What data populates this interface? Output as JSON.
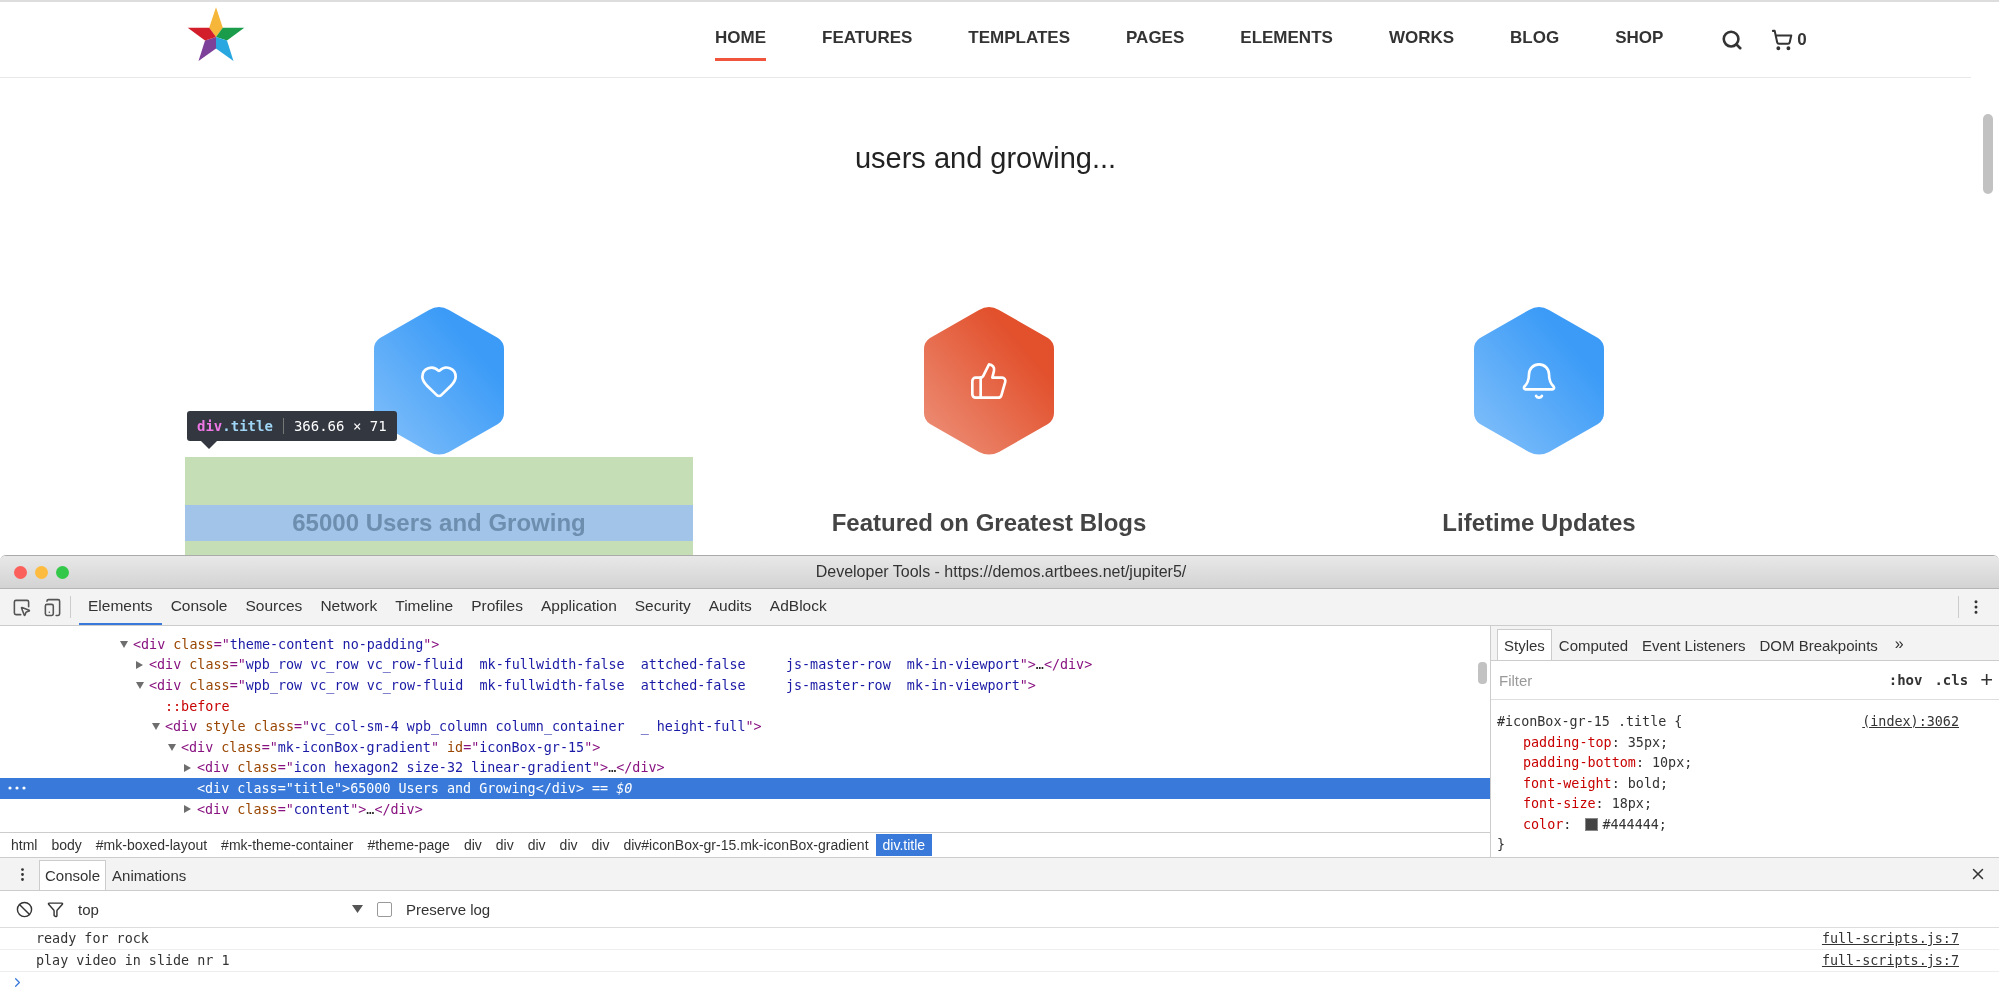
{
  "site": {
    "nav": [
      {
        "label": "HOME",
        "selected": true
      },
      {
        "label": "FEATURES",
        "selected": false
      },
      {
        "label": "TEMPLATES",
        "selected": false
      },
      {
        "label": "PAGES",
        "selected": false
      },
      {
        "label": "ELEMENTS",
        "selected": false
      },
      {
        "label": "WORKS",
        "selected": false
      },
      {
        "label": "BLOG",
        "selected": false
      },
      {
        "label": "SHOP",
        "selected": false
      }
    ],
    "cart_count": "0",
    "tagline": "users and growing...",
    "features": [
      {
        "title": "65000 Users and Growing",
        "color": "#3b9bf7",
        "highlighted": true
      },
      {
        "title": "Featured on Greatest Blogs",
        "color": "#e2502c",
        "highlighted": false
      },
      {
        "title": "Lifetime Updates",
        "color": "#3b9bf7",
        "highlighted": false
      }
    ],
    "inspect_tooltip": {
      "tag": "div",
      "class_name": ".title",
      "size": "366.66 × 71"
    }
  },
  "devtools": {
    "title": "Developer Tools - https://demos.artbees.net/jupiter5/",
    "tabs": [
      {
        "label": "Elements",
        "selected": true
      },
      {
        "label": "Console",
        "selected": false
      },
      {
        "label": "Sources",
        "selected": false
      },
      {
        "label": "Network",
        "selected": false
      },
      {
        "label": "Timeline",
        "selected": false
      },
      {
        "label": "Profiles",
        "selected": false
      },
      {
        "label": "Application",
        "selected": false
      },
      {
        "label": "Security",
        "selected": false
      },
      {
        "label": "Audits",
        "selected": false
      },
      {
        "label": "AdBlock",
        "selected": false
      }
    ],
    "dom_tree": [
      {
        "expanded": true,
        "selected": false,
        "segments": [
          {
            "kind": "tag",
            "text": "<div "
          },
          {
            "kind": "attr",
            "text": "class"
          },
          {
            "kind": "tag",
            "text": "=\""
          },
          {
            "kind": "value",
            "text": "theme-content no-padding"
          },
          {
            "kind": "tag",
            "text": "\">"
          }
        ],
        "children": [
          {
            "expanded": false,
            "selected": false,
            "segments": [
              {
                "kind": "tag",
                "text": "<div "
              },
              {
                "kind": "attr",
                "text": "class"
              },
              {
                "kind": "tag",
                "text": "=\""
              },
              {
                "kind": "value",
                "text": "wpb_row vc_row vc_row-fluid  mk-fullwidth-false  attched-false     js-master-row  mk-in-viewport"
              },
              {
                "kind": "tag",
                "text": "\">"
              },
              {
                "kind": "text",
                "text": "…"
              },
              {
                "kind": "tag",
                "text": "</div>"
              }
            ]
          },
          {
            "expanded": true,
            "selected": false,
            "segments": [
              {
                "kind": "tag",
                "text": "<div "
              },
              {
                "kind": "attr",
                "text": "class"
              },
              {
                "kind": "tag",
                "text": "=\""
              },
              {
                "kind": "value",
                "text": "wpb_row vc_row vc_row-fluid  mk-fullwidth-false  attched-false     js-master-row  mk-in-viewport"
              },
              {
                "kind": "tag",
                "text": "\">"
              }
            ],
            "children": [
              {
                "selected": false,
                "segments": [
                  {
                    "kind": "pseudo",
                    "text": "::before"
                  }
                ]
              },
              {
                "expanded": true,
                "selected": false,
                "segments": [
                  {
                    "kind": "tag",
                    "text": "<div "
                  },
                  {
                    "kind": "attr",
                    "text": "style class"
                  },
                  {
                    "kind": "tag",
                    "text": "=\""
                  },
                  {
                    "kind": "value",
                    "text": "vc_col-sm-4 wpb_column column_container  _ height-full"
                  },
                  {
                    "kind": "tag",
                    "text": "\">"
                  }
                ],
                "children": [
                  {
                    "expanded": true,
                    "selected": false,
                    "segments": [
                      {
                        "kind": "tag",
                        "text": "<div "
                      },
                      {
                        "kind": "attr",
                        "text": "class"
                      },
                      {
                        "kind": "tag",
                        "text": "=\""
                      },
                      {
                        "kind": "value",
                        "text": "mk-iconBox-gradient"
                      },
                      {
                        "kind": "tag",
                        "text": "\" "
                      },
                      {
                        "kind": "attr",
                        "text": "id"
                      },
                      {
                        "kind": "tag",
                        "text": "=\""
                      },
                      {
                        "kind": "value",
                        "text": "iconBox-gr-15"
                      },
                      {
                        "kind": "tag",
                        "text": "\">"
                      }
                    ],
                    "children": [
                      {
                        "expanded": false,
                        "selected": false,
                        "segments": [
                          {
                            "kind": "tag",
                            "text": "<div "
                          },
                          {
                            "kind": "attr",
                            "text": "class"
                          },
                          {
                            "kind": "tag",
                            "text": "=\""
                          },
                          {
                            "kind": "value",
                            "text": "icon hexagon2 size-32 linear-gradient"
                          },
                          {
                            "kind": "tag",
                            "text": "\">"
                          },
                          {
                            "kind": "text",
                            "text": "…"
                          },
                          {
                            "kind": "tag",
                            "text": "</div>"
                          }
                        ]
                      },
                      {
                        "selected": true,
                        "segments": [
                          {
                            "kind": "tag",
                            "text": "<div "
                          },
                          {
                            "kind": "attr",
                            "text": "class"
                          },
                          {
                            "kind": "tag",
                            "text": "=\""
                          },
                          {
                            "kind": "value",
                            "text": "title"
                          },
                          {
                            "kind": "tag",
                            "text": "\">"
                          },
                          {
                            "kind": "text",
                            "text": "65000 Users and Growing"
                          },
                          {
                            "kind": "tag",
                            "text": "</div>"
                          },
                          {
                            "kind": "note",
                            "text": " == $0"
                          }
                        ]
                      },
                      {
                        "expanded": false,
                        "selected": false,
                        "segments": [
                          {
                            "kind": "tag",
                            "text": "<div "
                          },
                          {
                            "kind": "attr",
                            "text": "class"
                          },
                          {
                            "kind": "tag",
                            "text": "=\""
                          },
                          {
                            "kind": "value",
                            "text": "content"
                          },
                          {
                            "kind": "tag",
                            "text": "\">"
                          },
                          {
                            "kind": "text",
                            "text": "…"
                          },
                          {
                            "kind": "tag",
                            "text": "</div>"
                          }
                        ]
                      }
                    ]
                  }
                ]
              }
            ]
          }
        ]
      }
    ],
    "breadcrumbs": [
      {
        "label": "html",
        "selected": false
      },
      {
        "label": "body",
        "selected": false
      },
      {
        "label": "#mk-boxed-layout",
        "selected": false
      },
      {
        "label": "#mk-theme-container",
        "selected": false
      },
      {
        "label": "#theme-page",
        "selected": false
      },
      {
        "label": "div",
        "selected": false
      },
      {
        "label": "div",
        "selected": false
      },
      {
        "label": "div",
        "selected": false
      },
      {
        "label": "div",
        "selected": false
      },
      {
        "label": "div",
        "selected": false
      },
      {
        "label": "div#iconBox-gr-15.mk-iconBox-gradient",
        "selected": false
      },
      {
        "label": "div.title",
        "selected": true
      }
    ],
    "styles": {
      "tabs": [
        {
          "label": "Styles",
          "selected": true
        },
        {
          "label": "Computed",
          "selected": false
        },
        {
          "label": "Event Listeners",
          "selected": false
        },
        {
          "label": "DOM Breakpoints",
          "selected": false
        }
      ],
      "more": "»",
      "filter_placeholder": "Filter",
      "hov": ":hov",
      "cls": ".cls",
      "add": "+",
      "rule": {
        "selector": "#iconBox-gr-15 .title {",
        "source": "(index):3062",
        "separator": ":",
        "declarations": [
          {
            "property": "padding-top",
            "value": "35px;"
          },
          {
            "property": "padding-bottom",
            "value": "10px;"
          },
          {
            "property": "font-weight",
            "value": "bold;"
          },
          {
            "property": "font-size",
            "value": "18px;"
          },
          {
            "property": "color",
            "value": "#444444;",
            "color": "#444444"
          }
        ],
        "close": "}"
      }
    },
    "drawer": {
      "tabs": [
        {
          "label": "Console",
          "selected": true
        },
        {
          "label": "Animations",
          "selected": false
        }
      ],
      "context": "top",
      "preserve_log": {
        "label": "Preserve log",
        "checked": false
      },
      "messages": [
        {
          "text": "ready for rock",
          "source": "full-scripts.js:7"
        },
        {
          "text": "play video in slide nr 1",
          "source": "full-scripts.js:7"
        }
      ]
    }
  }
}
